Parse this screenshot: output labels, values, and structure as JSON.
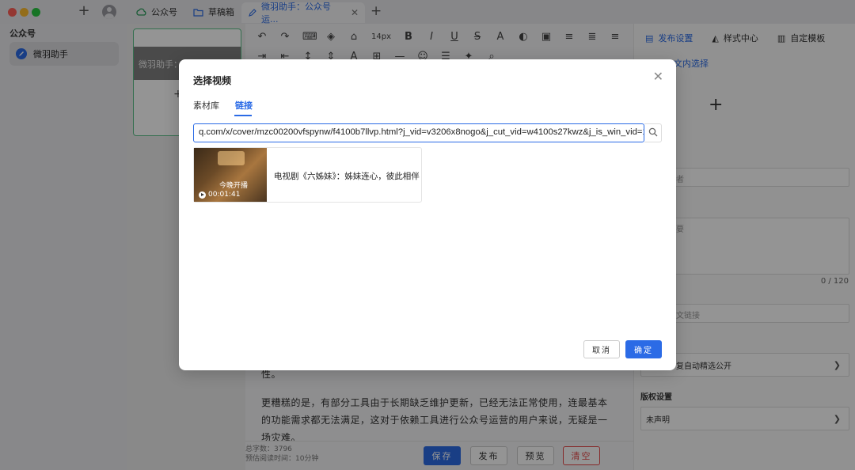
{
  "window": {
    "tabs": [
      {
        "label": "公众号",
        "icon": "cloud-icon"
      },
      {
        "label": "草稿箱",
        "icon": "folder-icon"
      },
      {
        "label": "微羽助手：公众号运...",
        "icon": "edit-icon",
        "active": true
      }
    ]
  },
  "sidebar": {
    "title": "公众号",
    "items": [
      {
        "label": "微羽助手",
        "icon": "pen-icon"
      }
    ]
  },
  "card": {
    "label": "微羽助手："
  },
  "editor": {
    "toolbar_fontsize": "14px",
    "paragraph_1": "性。",
    "paragraph_2": "更糟糕的是，有部分工具由于长期缺乏维护更新，已经无法正常使用，连最基本的功能需求都无法满足，这对于依赖工具进行公众号运营的用户来说，无疑是一场灾难。",
    "word_count_label": "总字数：3796",
    "reading_time_label": "预估阅读时间：10分钟",
    "save_label": "保存",
    "publish_label": "发布",
    "preview_label": "预览",
    "clear_label": "清空"
  },
  "right_panel": {
    "tabs": [
      "发布设置",
      "样式中心",
      "自定模板"
    ],
    "link_text": "文内选择",
    "author_placeholder": "者",
    "summary_placeholder": "要",
    "summary_count": "0 / 120",
    "source_placeholder": "文链接",
    "auto_select_label": "复自动精选公开",
    "copyright_section": "版权设置",
    "copyright_value": "未声明"
  },
  "modal": {
    "title": "选择视频",
    "tabs": [
      "素材库",
      "链接"
    ],
    "active_tab": "链接",
    "url_value": "q.com/x/cover/mzc00200vfspynw/f4100b7llvp.html?j_vid=v3206x8nogo&j_cut_vid=w4100s27kwz&j_is_win_vid=1",
    "video": {
      "title": "电视剧《六姊妹》：姊妹连心，彼此相伴",
      "thumb_caption": "今晚开播",
      "duration": "00:01:41"
    },
    "cancel_label": "取消",
    "confirm_label": "确定"
  },
  "colors": {
    "accent": "#2b6be6",
    "danger": "#e54848",
    "overlay": "rgba(0,0,0,0.42)"
  }
}
